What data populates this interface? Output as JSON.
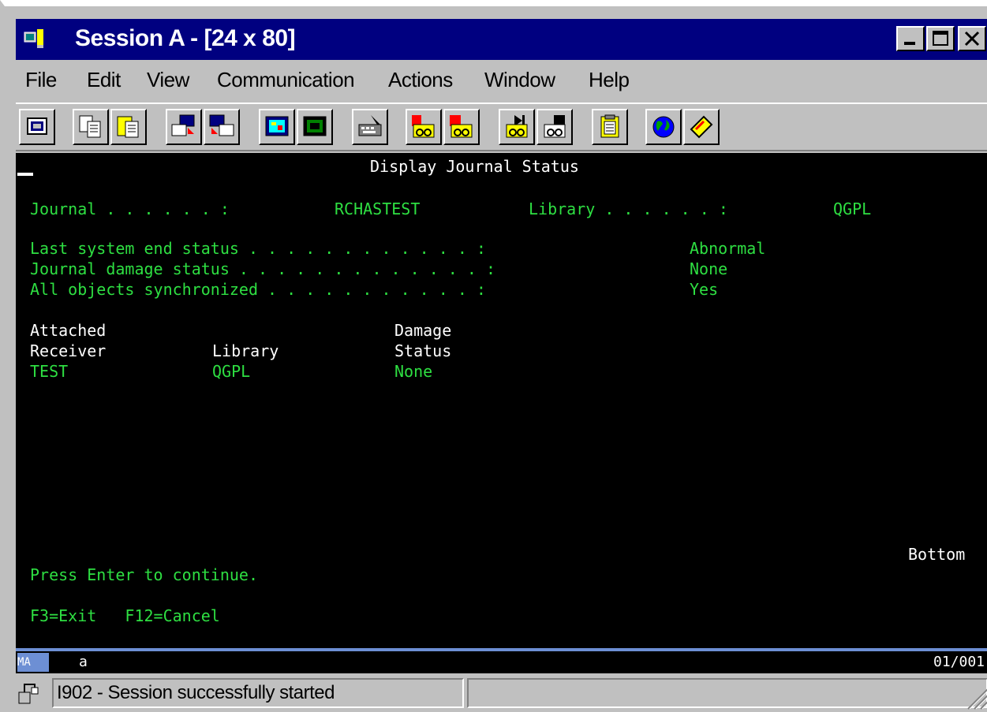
{
  "window": {
    "title": "Session A - [24 x 80]",
    "title_bar_color": "#000080"
  },
  "menu": {
    "items": [
      {
        "label": "File"
      },
      {
        "label": "Edit"
      },
      {
        "label": "View"
      },
      {
        "label": "Communication"
      },
      {
        "label": "Actions"
      },
      {
        "label": "Window"
      },
      {
        "label": "Help"
      }
    ]
  },
  "toolbar": {
    "buttons": [
      {
        "icon": "display-icon"
      },
      {
        "icon": "copy-icon"
      },
      {
        "icon": "paste-icon"
      },
      {
        "icon": "send-file-icon"
      },
      {
        "icon": "receive-file-icon"
      },
      {
        "icon": "display-setup-icon"
      },
      {
        "icon": "color-map-icon"
      },
      {
        "icon": "keyboard-map-icon"
      },
      {
        "icon": "macro-record-icon"
      },
      {
        "icon": "macro-stop-icon"
      },
      {
        "icon": "macro-play-icon"
      },
      {
        "icon": "macro-edit-icon"
      },
      {
        "icon": "clipboard-icon"
      },
      {
        "icon": "globe-icon"
      },
      {
        "icon": "help-tag-icon"
      }
    ]
  },
  "terminal": {
    "colors": {
      "text_white": "#ffffff",
      "text_green": "#2edf42",
      "background": "#000000"
    },
    "screen_title": "Display Journal Status",
    "journal_label": "Journal . . . . . . :",
    "journal_value": "RCHASTEST",
    "library_label": "Library . . . . . . :",
    "library_value": "QGPL",
    "status_rows": [
      {
        "label": "Last system end status . . . . . . . . . . . . :",
        "value": "Abnormal"
      },
      {
        "label": "Journal damage status . . . . . . . . . . . . . :",
        "value": "None"
      },
      {
        "label": "All objects synchronized . . . . . . . . . . . :",
        "value": "Yes"
      }
    ],
    "col_headers": {
      "receiver_line1": "Attached",
      "receiver_line2": "Receiver",
      "library": "Library",
      "damage_line1": "Damage",
      "damage_line2": "Status"
    },
    "receiver_row": {
      "receiver": "TEST",
      "library": "QGPL",
      "status": "None"
    },
    "position_indicator": "Bottom",
    "prompt": "Press Enter to continue.",
    "function_keys": "F3=Exit   F12=Cancel"
  },
  "oia": {
    "indicator": "MA",
    "session_letter": "a",
    "cursor_position": "01/001"
  },
  "status_bar": {
    "message": "I902 - Session successfully started"
  }
}
